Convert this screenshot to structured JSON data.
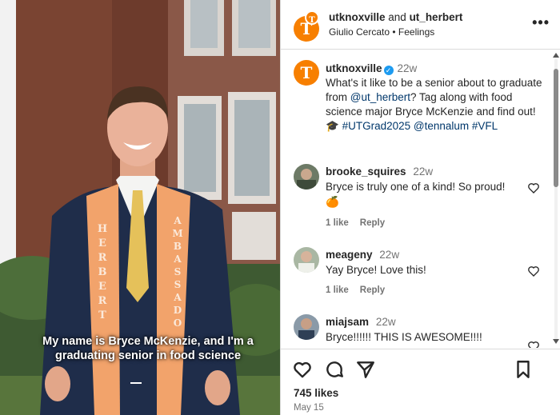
{
  "media": {
    "caption": "My name is Bryce McKenzie, and I'm a graduating senior in food science",
    "stole_left_text": "HERBERT",
    "stole_right_text": "AMBASSADOR"
  },
  "header": {
    "account_main": "utknoxville",
    "joiner": " and ",
    "account_collab": "ut_herbert",
    "subtitle": "Giulio Cercato • Feelings",
    "logo_letter": "T",
    "more_label": "•••"
  },
  "post": {
    "author": "utknoxville",
    "time": "22w",
    "caption_text_1": "What's it like to be a senior about to graduate from ",
    "mention": "@ut_herbert",
    "caption_text_2": "? Tag along with food science major Bryce McKenzie and find out! 🎓 ",
    "hashtag1": "#UTGrad2025",
    "mention2": "@tennalum",
    "hashtag2": "#VFL"
  },
  "comments": [
    {
      "user": "brooke_squires",
      "time": "22w",
      "text": "Bryce is truly one of a kind! So proud! 🍊",
      "likes": "1 like",
      "reply": "Reply"
    },
    {
      "user": "meageny",
      "time": "22w",
      "text": "Yay Bryce! Love this!",
      "likes": "1 like",
      "reply": "Reply"
    },
    {
      "user": "miajsam",
      "time": "22w",
      "text": "Bryce!!!!!! THIS IS AWESOME!!!!",
      "likes": "",
      "reply": ""
    }
  ],
  "footer": {
    "likes": "745 likes",
    "date": "May 15"
  },
  "colors": {
    "ut_orange": "#f77f00",
    "link_blue": "#00376b",
    "verified_blue": "#1d9bf0"
  }
}
